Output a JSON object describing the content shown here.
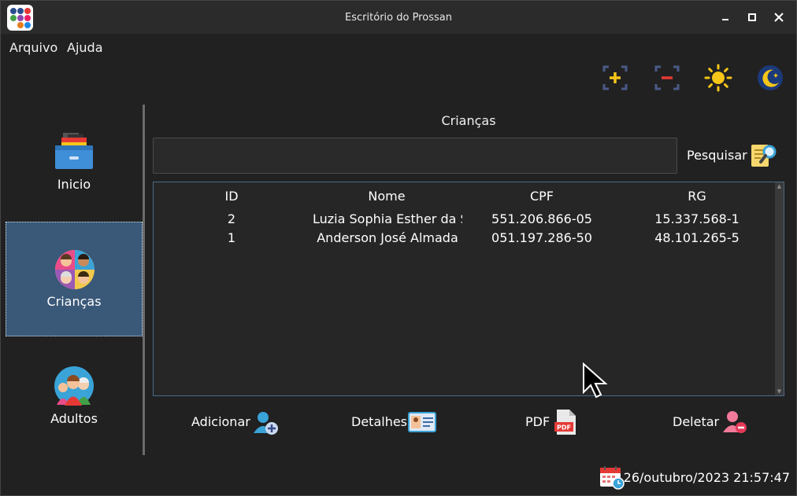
{
  "window": {
    "title": "Escritório do Prossan"
  },
  "menu": {
    "file": "Arquivo",
    "help": "Ajuda"
  },
  "toolbar": {
    "zoom_in_icon": "zoom-in-icon",
    "zoom_out_icon": "zoom-out-icon",
    "light_theme_icon": "sun-icon",
    "dark_theme_icon": "moon-icon",
    "accent": "#f5c518"
  },
  "sidebar": {
    "items": [
      {
        "label": "Inicio",
        "icon": "drawer-icon"
      },
      {
        "label": "Crianças",
        "icon": "children-icon"
      },
      {
        "label": "Adultos",
        "icon": "family-icon"
      }
    ],
    "active_color": "#3a5878"
  },
  "main": {
    "title": "Crianças",
    "search": {
      "value": "",
      "placeholder": "",
      "button_label": "Pesquisar"
    },
    "table": {
      "columns": [
        "ID",
        "Nome",
        "CPF",
        "RG"
      ],
      "rows": [
        {
          "id": "2",
          "name": "Luzia Sophia Esther da S",
          "cpf": "551.206.866-05",
          "rg": "15.337.568-1"
        },
        {
          "id": "1",
          "name": "Anderson José Almada",
          "cpf": "051.197.286-50",
          "rg": "48.101.265-5"
        }
      ]
    },
    "actions": {
      "add": "Adicionar",
      "details": "Detalhes",
      "pdf": "PDF",
      "delete": "Deletar"
    },
    "pdf_badge": "PDF"
  },
  "status": {
    "datetime": "26/outubro/2023 21:57:47"
  }
}
